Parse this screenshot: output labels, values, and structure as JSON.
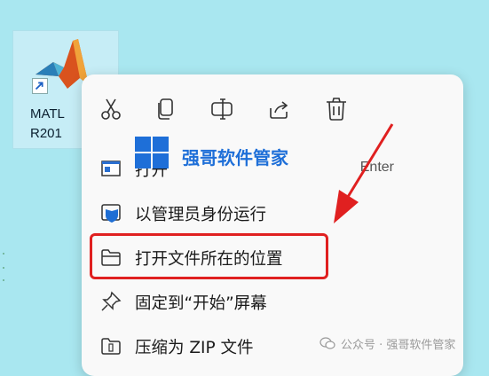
{
  "desktop": {
    "icon_name": "matlab-shortcut",
    "label_line1": "MATL",
    "label_line2": "R201"
  },
  "context_menu": {
    "quick_actions": [
      {
        "name": "cut",
        "icon": "scissors-icon"
      },
      {
        "name": "copy",
        "icon": "copy-icon"
      },
      {
        "name": "rename",
        "icon": "rename-icon"
      },
      {
        "name": "share",
        "icon": "share-icon"
      },
      {
        "name": "delete",
        "icon": "trash-icon"
      }
    ],
    "items": [
      {
        "label": "打开",
        "shortcut": "Enter",
        "icon": "open-window-icon"
      },
      {
        "label": "以管理员身份运行",
        "shortcut": "",
        "icon": "shield-icon"
      },
      {
        "label": "打开文件所在的位置",
        "shortcut": "",
        "icon": "folder-icon"
      },
      {
        "label": "固定到“开始”屏幕",
        "shortcut": "",
        "icon": "pin-icon"
      },
      {
        "label": "压缩为 ZIP 文件",
        "shortcut": "",
        "icon": "zip-icon"
      }
    ]
  },
  "watermark": {
    "text": "强哥软件管家"
  },
  "footer": {
    "text": "公众号 · 强哥软件管家"
  },
  "colors": {
    "desktop_bg": "#a9e7f0",
    "highlight": "#e02020",
    "watermark": "#1e6fd8"
  }
}
